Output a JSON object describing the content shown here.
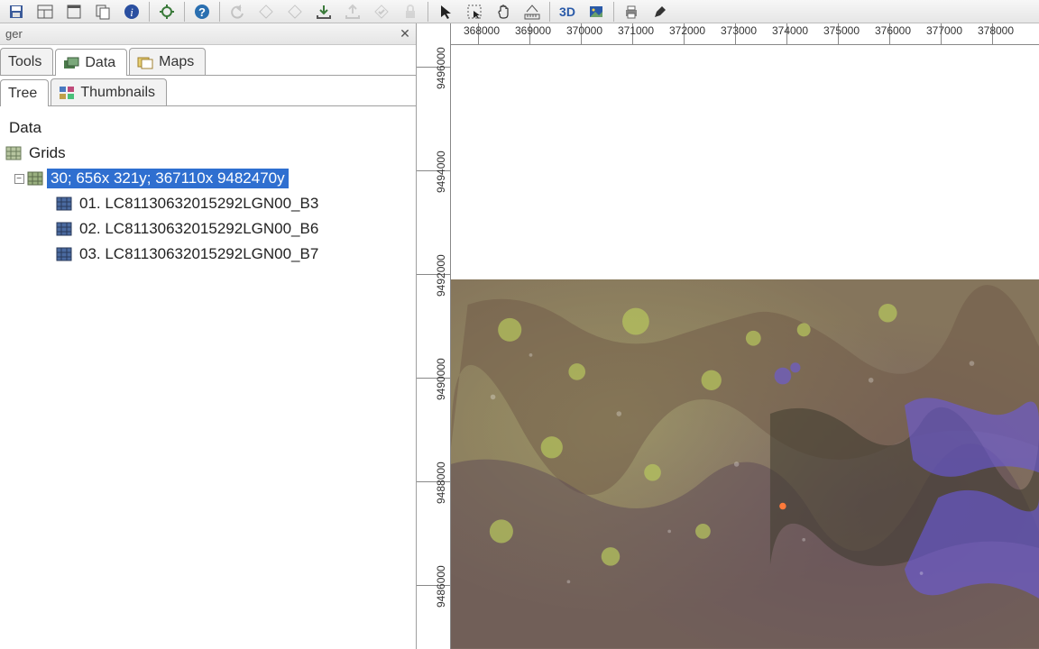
{
  "panel": {
    "title": "ger",
    "top_tabs": {
      "tools": "Tools",
      "data": "Data",
      "maps": "Maps"
    },
    "sub_tabs": {
      "tree": "Tree",
      "thumbnails": "Thumbnails"
    }
  },
  "tree": {
    "root": "Data",
    "grids": "Grids",
    "grid_system": "30; 656x 321y; 367110x 9482470y",
    "layers": [
      "01. LC81130632015292LGN00_B3",
      "02. LC81130632015292LGN00_B6",
      "03. LC81130632015292LGN00_B7"
    ]
  },
  "map": {
    "x_ticks": [
      "368000",
      "369000",
      "370000",
      "371000",
      "372000",
      "373000",
      "374000",
      "375000",
      "376000",
      "377000",
      "378000"
    ],
    "y_ticks": [
      "9496000",
      "9494000",
      "9492000",
      "9490000",
      "9488000",
      "9486000"
    ]
  },
  "toolbar_icons": [
    "save-icon",
    "layout-icon",
    "window-icon",
    "copy-icon",
    "info-icon",
    "sep",
    "gear-icon",
    "sep",
    "help-icon",
    "sep",
    "undo-icon",
    "shape-left-icon",
    "shape-right-icon",
    "export-icon",
    "import-icon",
    "check-icon",
    "lock-icon",
    "sep",
    "pointer-icon",
    "select-box-icon",
    "pan-icon",
    "measure-icon",
    "sep",
    "3d-icon",
    "image-icon",
    "sep",
    "print-icon",
    "pen-icon"
  ]
}
